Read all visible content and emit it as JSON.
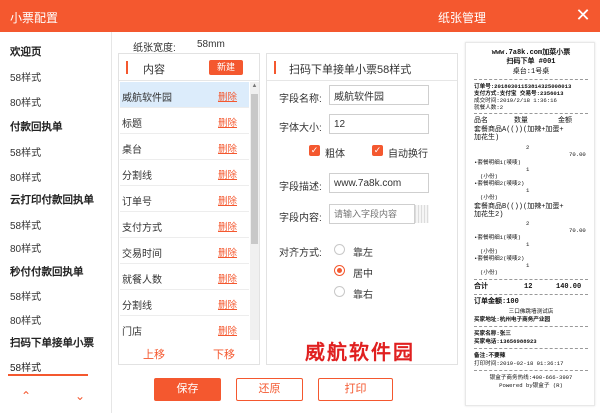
{
  "window": {
    "title": "小票配置",
    "paper_title": "纸张管理"
  },
  "sidebar": {
    "items": [
      {
        "label": "欢迎页",
        "group": true
      },
      {
        "label": "58样式",
        "group": false
      },
      {
        "label": "80样式",
        "group": false
      },
      {
        "label": "付款回执单",
        "group": true
      },
      {
        "label": "58样式",
        "group": false
      },
      {
        "label": "80样式",
        "group": false
      },
      {
        "label": "云打印付款回执单",
        "group": true
      },
      {
        "label": "58样式",
        "group": false
      },
      {
        "label": "80样式",
        "group": false
      },
      {
        "label": "秒付付款回执单",
        "group": true
      },
      {
        "label": "58样式",
        "group": false
      },
      {
        "label": "80样式",
        "group": false
      },
      {
        "label": "扫码下单接单小票",
        "group": true
      },
      {
        "label": "58样式",
        "group": false,
        "active": true
      }
    ]
  },
  "paper": {
    "width_label": "纸张宽度:",
    "width_value": "58mm"
  },
  "content_panel": {
    "title": "内容",
    "new_label": "新建",
    "delete_label": "删除",
    "rows": [
      "威航软件园",
      "标题",
      "桌台",
      "分割线",
      "订单号",
      "支付方式",
      "交易时间",
      "就餐人数",
      "分割线",
      "门店"
    ],
    "move_up": "上移",
    "move_down": "下移"
  },
  "settings_panel": {
    "title": "扫码下单接单小票58样式",
    "field_name_label": "字段名称:",
    "field_name_value": "威航软件园",
    "font_size_label": "字体大小:",
    "font_size_value": "12",
    "bold_label": "粗体",
    "wrap_label": "自动换行",
    "desc_label": "字段描述:",
    "desc_value": "www.7a8k.com",
    "content_label": "字段内容:",
    "content_placeholder": "请输入字段内容",
    "align_label": "对齐方式:",
    "align_left": "靠左",
    "align_center": "居中",
    "align_right": "靠右"
  },
  "watermark": "威航软件园",
  "buttons": {
    "save": "保存",
    "restore": "还原",
    "print": "打印"
  },
  "receipt": {
    "title_line": "www.7a8k.com加菜小票",
    "subtitle": "扫码下单 #001",
    "table_line": "桌台:1号桌",
    "order_no": "订单号:20180301153814325008013",
    "pay_method": "支付方式:支付宝 交易号:2356013",
    "trade_time": "成交时间:2019/2/18 1:36:16",
    "diners": "就餐人数:2",
    "head_name": "品名",
    "head_qty": "数量",
    "head_amount": "金额",
    "item1_name": "套餐商品A(())(加辣+加蛋+",
    "item1_name2": "加花生)",
    "item1_qty": "2",
    "item1_amount": "70.00",
    "sub1": "•套餐明细1(唛唛)",
    "sub1_qty": "1",
    "sub1_note": "(小份)",
    "sub2": "•套餐明细2(唛唛2)",
    "sub2_qty": "1",
    "sub2_note": "(小份)",
    "item2_name": "套餐商品B(())(加辣+加蛋+",
    "item2_name2": "加花生2)",
    "item2_qty": "2",
    "item2_amount": "70.00",
    "sub3": "•套餐明细1(唛唛)",
    "sub3_qty": "1",
    "sub3_note": "(小份)",
    "sub4": "•套餐明细2(唛唛2)",
    "sub4_qty": "1",
    "sub4_note": "(小份)",
    "total_label": "合计",
    "total_qty": "12",
    "total_amount": "140.00",
    "order_amount": "订单金额:100",
    "store": "三口佛跳墙测试店",
    "address": "买家地址:杭州电子商务产业园",
    "buyer": "买家名称:张三",
    "phone": "买家电话:13656988923",
    "remark": "备注:不要辣",
    "print_time": "打印时间:2019-02-18 01:36:17",
    "hotline": "银盒子商务热线:400-666-3907",
    "powered": "Powered by银盒子 (R)"
  }
}
